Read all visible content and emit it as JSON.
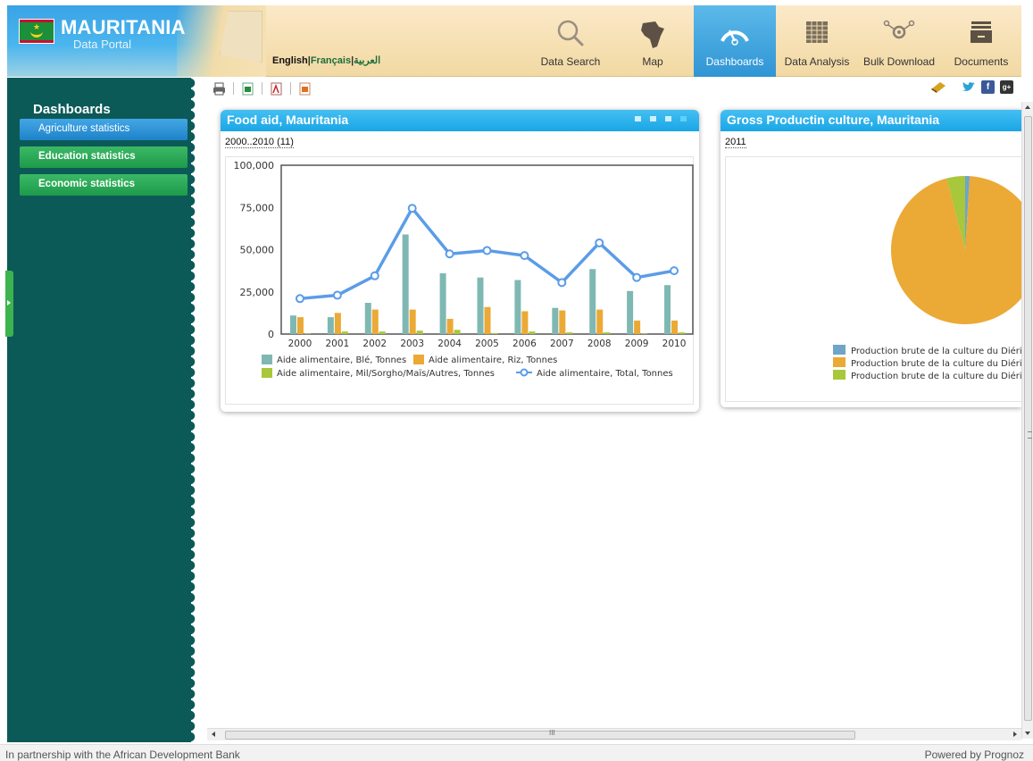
{
  "header": {
    "brand_title": "MAURITANIA",
    "brand_subtitle": "Data Portal",
    "lang_en": "English",
    "lang_fr": "Français",
    "lang_ar": "العربية",
    "lang_sep": "|",
    "nav": [
      {
        "label": "Data Search",
        "icon": "magnifier-icon"
      },
      {
        "label": "Map",
        "icon": "africa-map-icon"
      },
      {
        "label": "Dashboards",
        "icon": "gauge-icon",
        "active": true
      },
      {
        "label": "Data Analysis",
        "icon": "grid-table-icon"
      },
      {
        "label": "Bulk Download",
        "icon": "network-icon"
      },
      {
        "label": "Documents",
        "icon": "document-tray-icon"
      }
    ]
  },
  "sidebar": {
    "title": "Dashboards",
    "items": [
      {
        "label": "Agriculture statistics",
        "active": true
      },
      {
        "label": "Education statistics",
        "active": false
      },
      {
        "label": "Economic statistics",
        "active": false
      }
    ]
  },
  "panels": {
    "food_aid": {
      "title": "Food aid, Mauritania",
      "period": "2000..2010 (11)"
    },
    "gross_prod": {
      "title": "Gross Productin culture, Mauritania",
      "period": "2011"
    }
  },
  "colors": {
    "wheat": "#7fb8b2",
    "rice": "#eba935",
    "millet": "#a8c73b",
    "total": "#5b9ce8",
    "pie_blue": "#6ea5c9"
  },
  "chart_data": [
    {
      "type": "bar",
      "title": "",
      "categories": [
        "2000",
        "2001",
        "2002",
        "2003",
        "2004",
        "2005",
        "2006",
        "2007",
        "2008",
        "2009",
        "2010"
      ],
      "ylim": [
        0,
        100000
      ],
      "yticks": [
        "0",
        "25,000",
        "50,000",
        "75,000",
        "100,000"
      ],
      "series": [
        {
          "name": "Aide alimentaire, Blé, Tonnes",
          "kind": "bar",
          "values": [
            11000,
            10000,
            18500,
            59000,
            36000,
            33500,
            32000,
            15500,
            38500,
            25500,
            29000
          ]
        },
        {
          "name": "Aide alimentaire, Riz, Tonnes",
          "kind": "bar",
          "values": [
            10000,
            12500,
            14500,
            14500,
            9000,
            16000,
            13500,
            14000,
            14500,
            8000,
            8000
          ]
        },
        {
          "name": "Aide alimentaire, Mil/Sorgho/Maïs/Autres, Tonnes",
          "kind": "bar",
          "values": [
            300,
            1500,
            1500,
            2000,
            2500,
            500,
            1500,
            1000,
            1000,
            300,
            1000
          ]
        },
        {
          "name": "Aide alimentaire, Total, Tonnes",
          "kind": "line",
          "values": [
            21000,
            23000,
            34500,
            74500,
            47500,
            49500,
            46500,
            30500,
            54000,
            33500,
            37500
          ]
        }
      ],
      "legend": "bottom"
    },
    {
      "type": "pie",
      "slices": [
        {
          "name": "Production brute de la culture du Diéri,",
          "value": 1
        },
        {
          "name": "Production brute de la culture du Diéri,",
          "value": 95
        },
        {
          "name": "Production brute de la culture du Diéri,",
          "value": 4
        }
      ],
      "legend": "bottom-right"
    }
  ],
  "footer": {
    "left": "In partnership with the African Development Bank",
    "right": "Powered by Prognoz"
  },
  "hscroll_marker": "III"
}
